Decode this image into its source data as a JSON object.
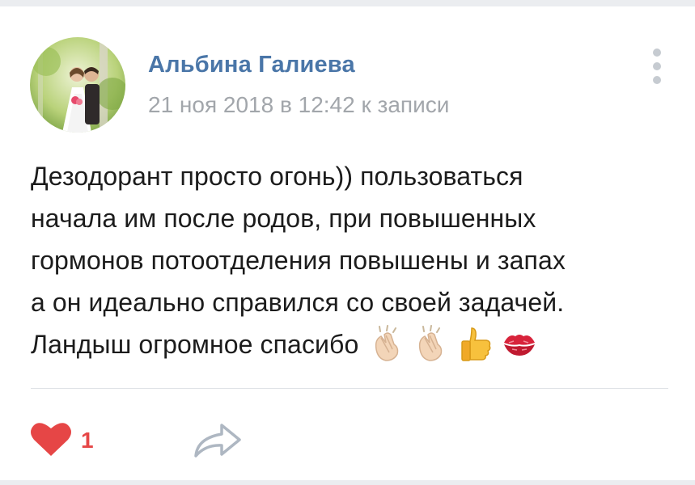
{
  "post": {
    "author_name": "Альбина Галиева",
    "meta": "21 ноя 2018 в 12:42 к записи",
    "text_lines": [
      "Дезодорант просто огонь)) пользоваться",
      "начала им после родов, при повышенных",
      "гормонов потоотделения повышены и запах",
      "а он идеально справился со своей задачей.",
      "Ландыш огромное спасибо"
    ],
    "emojis": [
      "clapping-hands-icon",
      "clapping-hands-icon",
      "thumbs-up-icon",
      "kiss-mark-icon"
    ]
  },
  "actions": {
    "like_count": "1",
    "like_icon": "heart-icon",
    "share_icon": "share-arrow-icon",
    "more_icon": "more-vertical-icon"
  },
  "colors": {
    "author_name": "#4a76a8",
    "meta": "#a2a6ab",
    "like": "#e64646",
    "icon_gray": "#c6cbd1"
  }
}
